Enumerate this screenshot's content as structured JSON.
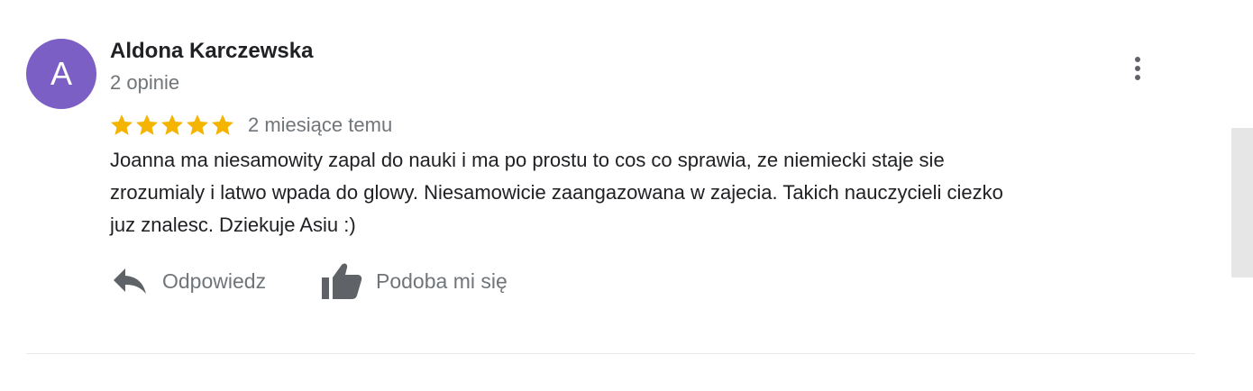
{
  "review": {
    "avatar_letter": "A",
    "avatar_color": "#7b5fc4",
    "author_name": "Aldona Karczewska",
    "review_count": "2 opinie",
    "rating": 5,
    "rating_max": 5,
    "star_color": "#f4b400",
    "time_ago": "2 miesiące temu",
    "text": "Joanna ma niesamowity zapal do nauki i ma po prostu to cos co sprawia, ze niemiecki staje sie zrozumialy i latwo wpada do glowy. Niesamowicie zaangazowana w zajecia. Takich nauczycieli ciezko juz znalesc. Dziekuje Asiu :)"
  },
  "actions": {
    "reply_label": "Odpowiedz",
    "like_label": "Podoba mi się",
    "reply_icon": "reply-arrow-icon",
    "like_icon": "thumbs-up-icon",
    "more_icon": "more-vertical-icon"
  }
}
